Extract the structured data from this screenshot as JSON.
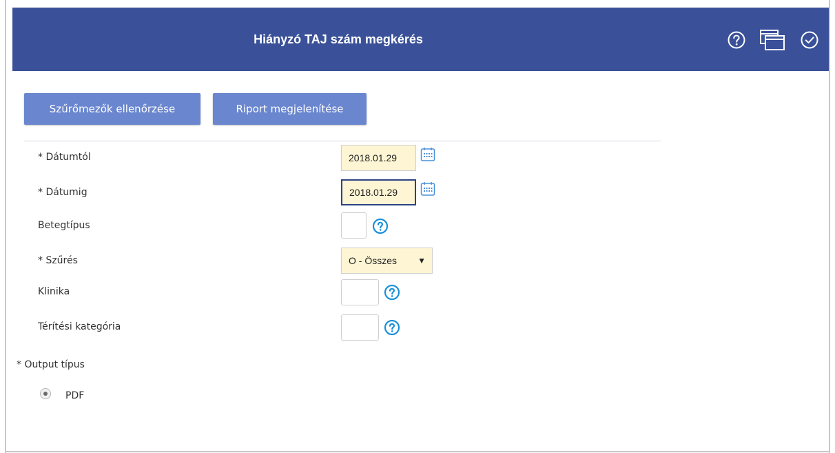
{
  "window": {
    "title": "Hiányzó TAJ szám megkérés",
    "icons": [
      "help-icon",
      "windows-icon",
      "check-icon"
    ]
  },
  "toolbar": {
    "check_filters_label": "Szűrőmezők ellenőrzése",
    "show_report_label": "Riport megjelenítése"
  },
  "form": {
    "date_from": {
      "label": "* Dátumtól",
      "value": "2018.01.29",
      "icon": "calendar-icon"
    },
    "date_to": {
      "label": "* Dátumig",
      "value": "2018.01.29",
      "icon": "calendar-icon"
    },
    "patient_type": {
      "label": "Betegtípus",
      "value": "",
      "icon": "help-icon"
    },
    "filter": {
      "label": "* Szűrés",
      "value": "O - Összes"
    },
    "clinic": {
      "label": "Klinika",
      "value": "",
      "icon": "help-icon"
    },
    "payment_category": {
      "label": "Térítési kategória",
      "value": "",
      "icon": "help-icon"
    }
  },
  "output": {
    "label": "* Output típus",
    "options": [
      {
        "label": "PDF",
        "selected": true
      }
    ]
  },
  "colors": {
    "header": "#3a5199",
    "button": "#6a86cf",
    "input_highlight": "#fdf5d3",
    "help_icon": "#1a8fd8"
  }
}
